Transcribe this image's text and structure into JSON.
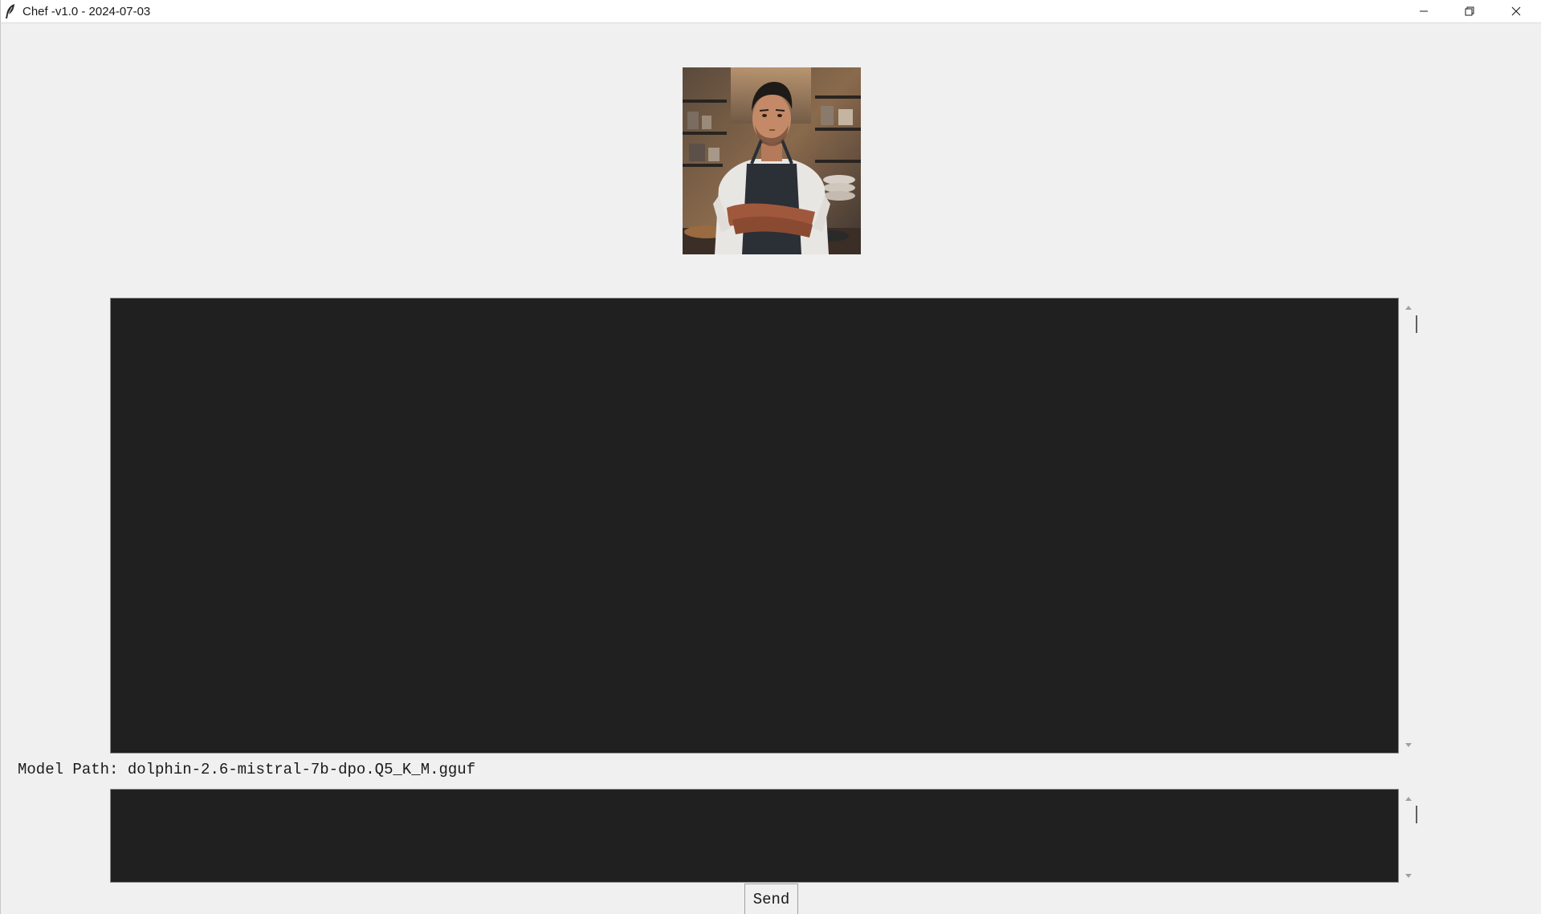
{
  "window": {
    "title": "Chef -v1.0 - 2024-07-03"
  },
  "titlebar_icons": {
    "app": "feather-icon",
    "minimize": "minimize-icon",
    "restore": "restore-icon",
    "close": "close-icon"
  },
  "avatar": {
    "description_icon": "chef-portrait"
  },
  "model": {
    "label": "Model Path:",
    "value": "dolphin-2.6-mistral-7b-dpo.Q5_K_M.gguf"
  },
  "actions": {
    "send_label": "Send"
  },
  "colors": {
    "text_area_bg": "#202020",
    "window_bg": "#f0f0f0"
  }
}
